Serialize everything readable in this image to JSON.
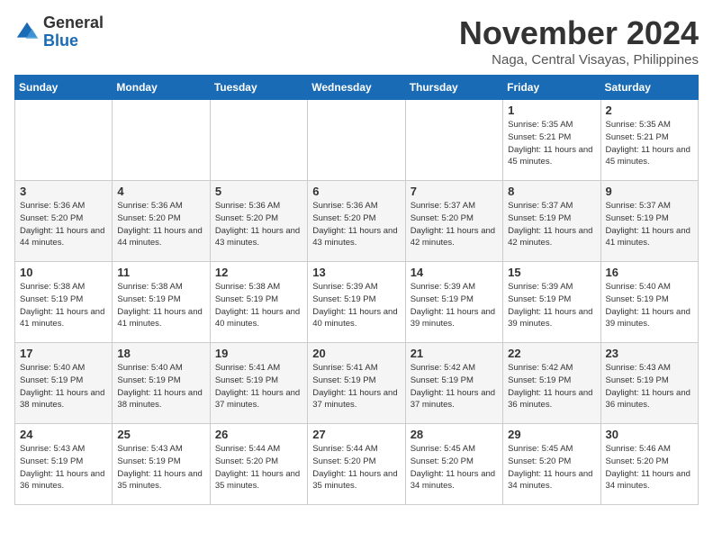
{
  "logo": {
    "general": "General",
    "blue": "Blue"
  },
  "header": {
    "month": "November 2024",
    "location": "Naga, Central Visayas, Philippines"
  },
  "weekdays": [
    "Sunday",
    "Monday",
    "Tuesday",
    "Wednesday",
    "Thursday",
    "Friday",
    "Saturday"
  ],
  "weeks": [
    [
      {
        "day": "",
        "sunrise": "",
        "sunset": "",
        "daylight": ""
      },
      {
        "day": "",
        "sunrise": "",
        "sunset": "",
        "daylight": ""
      },
      {
        "day": "",
        "sunrise": "",
        "sunset": "",
        "daylight": ""
      },
      {
        "day": "",
        "sunrise": "",
        "sunset": "",
        "daylight": ""
      },
      {
        "day": "",
        "sunrise": "",
        "sunset": "",
        "daylight": ""
      },
      {
        "day": "1",
        "sunrise": "Sunrise: 5:35 AM",
        "sunset": "Sunset: 5:21 PM",
        "daylight": "Daylight: 11 hours and 45 minutes."
      },
      {
        "day": "2",
        "sunrise": "Sunrise: 5:35 AM",
        "sunset": "Sunset: 5:21 PM",
        "daylight": "Daylight: 11 hours and 45 minutes."
      }
    ],
    [
      {
        "day": "3",
        "sunrise": "Sunrise: 5:36 AM",
        "sunset": "Sunset: 5:20 PM",
        "daylight": "Daylight: 11 hours and 44 minutes."
      },
      {
        "day": "4",
        "sunrise": "Sunrise: 5:36 AM",
        "sunset": "Sunset: 5:20 PM",
        "daylight": "Daylight: 11 hours and 44 minutes."
      },
      {
        "day": "5",
        "sunrise": "Sunrise: 5:36 AM",
        "sunset": "Sunset: 5:20 PM",
        "daylight": "Daylight: 11 hours and 43 minutes."
      },
      {
        "day": "6",
        "sunrise": "Sunrise: 5:36 AM",
        "sunset": "Sunset: 5:20 PM",
        "daylight": "Daylight: 11 hours and 43 minutes."
      },
      {
        "day": "7",
        "sunrise": "Sunrise: 5:37 AM",
        "sunset": "Sunset: 5:20 PM",
        "daylight": "Daylight: 11 hours and 42 minutes."
      },
      {
        "day": "8",
        "sunrise": "Sunrise: 5:37 AM",
        "sunset": "Sunset: 5:19 PM",
        "daylight": "Daylight: 11 hours and 42 minutes."
      },
      {
        "day": "9",
        "sunrise": "Sunrise: 5:37 AM",
        "sunset": "Sunset: 5:19 PM",
        "daylight": "Daylight: 11 hours and 41 minutes."
      }
    ],
    [
      {
        "day": "10",
        "sunrise": "Sunrise: 5:38 AM",
        "sunset": "Sunset: 5:19 PM",
        "daylight": "Daylight: 11 hours and 41 minutes."
      },
      {
        "day": "11",
        "sunrise": "Sunrise: 5:38 AM",
        "sunset": "Sunset: 5:19 PM",
        "daylight": "Daylight: 11 hours and 41 minutes."
      },
      {
        "day": "12",
        "sunrise": "Sunrise: 5:38 AM",
        "sunset": "Sunset: 5:19 PM",
        "daylight": "Daylight: 11 hours and 40 minutes."
      },
      {
        "day": "13",
        "sunrise": "Sunrise: 5:39 AM",
        "sunset": "Sunset: 5:19 PM",
        "daylight": "Daylight: 11 hours and 40 minutes."
      },
      {
        "day": "14",
        "sunrise": "Sunrise: 5:39 AM",
        "sunset": "Sunset: 5:19 PM",
        "daylight": "Daylight: 11 hours and 39 minutes."
      },
      {
        "day": "15",
        "sunrise": "Sunrise: 5:39 AM",
        "sunset": "Sunset: 5:19 PM",
        "daylight": "Daylight: 11 hours and 39 minutes."
      },
      {
        "day": "16",
        "sunrise": "Sunrise: 5:40 AM",
        "sunset": "Sunset: 5:19 PM",
        "daylight": "Daylight: 11 hours and 39 minutes."
      }
    ],
    [
      {
        "day": "17",
        "sunrise": "Sunrise: 5:40 AM",
        "sunset": "Sunset: 5:19 PM",
        "daylight": "Daylight: 11 hours and 38 minutes."
      },
      {
        "day": "18",
        "sunrise": "Sunrise: 5:40 AM",
        "sunset": "Sunset: 5:19 PM",
        "daylight": "Daylight: 11 hours and 38 minutes."
      },
      {
        "day": "19",
        "sunrise": "Sunrise: 5:41 AM",
        "sunset": "Sunset: 5:19 PM",
        "daylight": "Daylight: 11 hours and 37 minutes."
      },
      {
        "day": "20",
        "sunrise": "Sunrise: 5:41 AM",
        "sunset": "Sunset: 5:19 PM",
        "daylight": "Daylight: 11 hours and 37 minutes."
      },
      {
        "day": "21",
        "sunrise": "Sunrise: 5:42 AM",
        "sunset": "Sunset: 5:19 PM",
        "daylight": "Daylight: 11 hours and 37 minutes."
      },
      {
        "day": "22",
        "sunrise": "Sunrise: 5:42 AM",
        "sunset": "Sunset: 5:19 PM",
        "daylight": "Daylight: 11 hours and 36 minutes."
      },
      {
        "day": "23",
        "sunrise": "Sunrise: 5:43 AM",
        "sunset": "Sunset: 5:19 PM",
        "daylight": "Daylight: 11 hours and 36 minutes."
      }
    ],
    [
      {
        "day": "24",
        "sunrise": "Sunrise: 5:43 AM",
        "sunset": "Sunset: 5:19 PM",
        "daylight": "Daylight: 11 hours and 36 minutes."
      },
      {
        "day": "25",
        "sunrise": "Sunrise: 5:43 AM",
        "sunset": "Sunset: 5:19 PM",
        "daylight": "Daylight: 11 hours and 35 minutes."
      },
      {
        "day": "26",
        "sunrise": "Sunrise: 5:44 AM",
        "sunset": "Sunset: 5:20 PM",
        "daylight": "Daylight: 11 hours and 35 minutes."
      },
      {
        "day": "27",
        "sunrise": "Sunrise: 5:44 AM",
        "sunset": "Sunset: 5:20 PM",
        "daylight": "Daylight: 11 hours and 35 minutes."
      },
      {
        "day": "28",
        "sunrise": "Sunrise: 5:45 AM",
        "sunset": "Sunset: 5:20 PM",
        "daylight": "Daylight: 11 hours and 34 minutes."
      },
      {
        "day": "29",
        "sunrise": "Sunrise: 5:45 AM",
        "sunset": "Sunset: 5:20 PM",
        "daylight": "Daylight: 11 hours and 34 minutes."
      },
      {
        "day": "30",
        "sunrise": "Sunrise: 5:46 AM",
        "sunset": "Sunset: 5:20 PM",
        "daylight": "Daylight: 11 hours and 34 minutes."
      }
    ]
  ]
}
